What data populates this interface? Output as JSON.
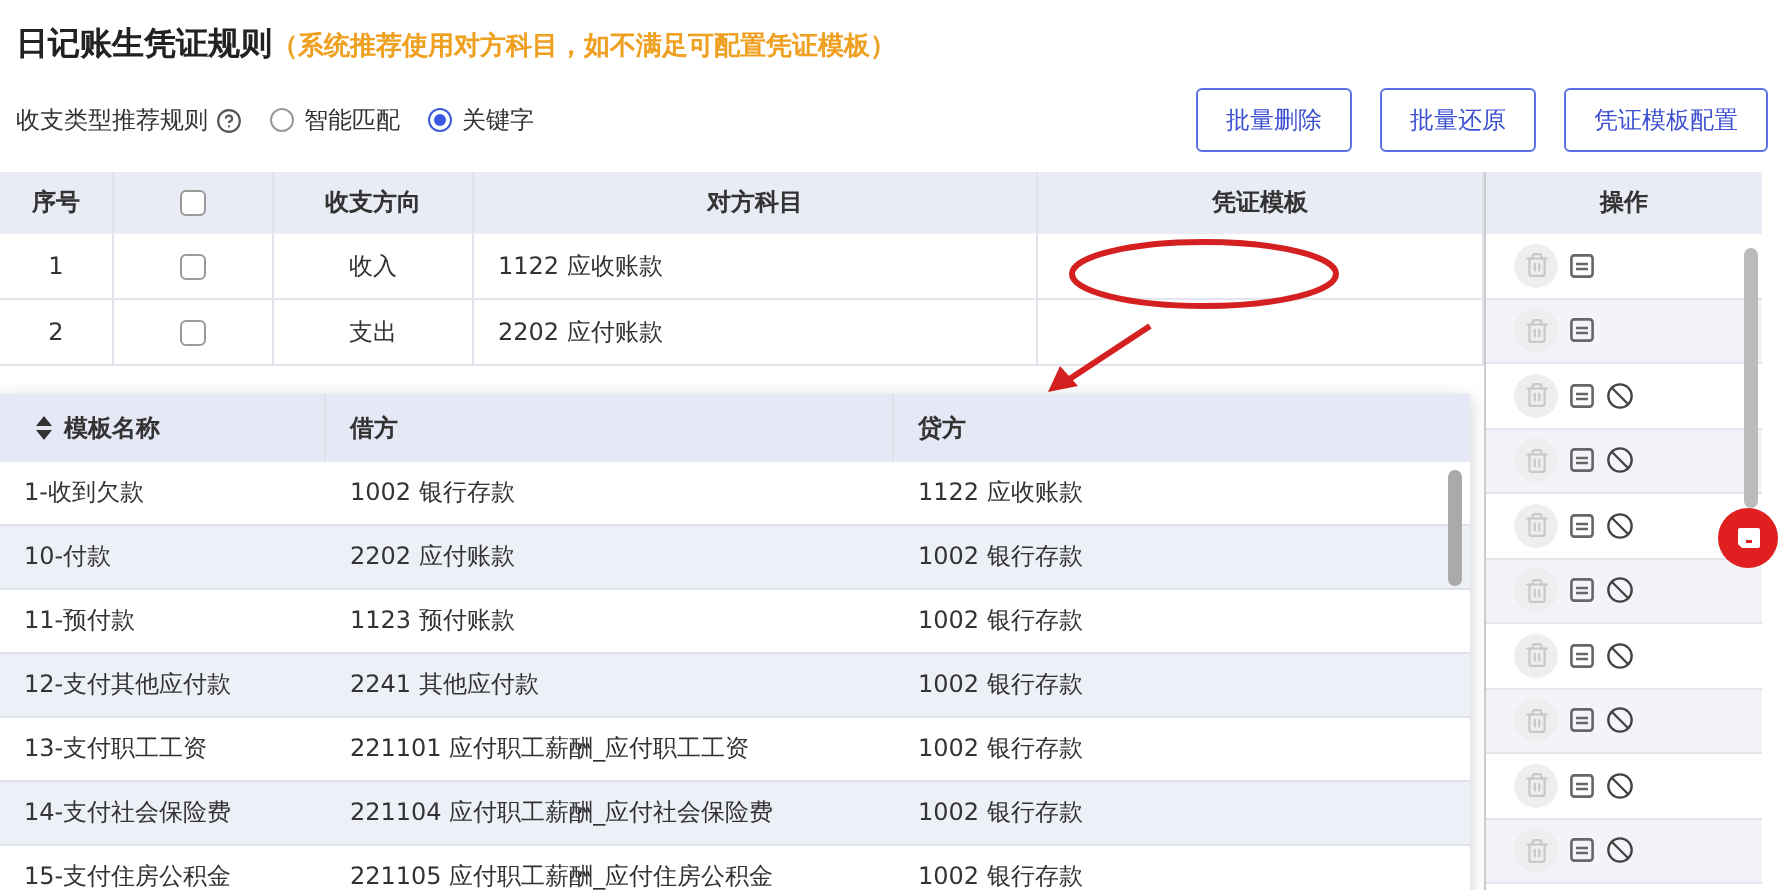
{
  "title": "日记账生凭证规则",
  "subtitle": "（系统推荐使用对方科目，如不满足可配置凭证模板）",
  "rule": {
    "label": "收支类型推荐规则",
    "options": [
      {
        "label": "智能匹配",
        "selected": false
      },
      {
        "label": "关键字",
        "selected": true
      }
    ]
  },
  "buttons": [
    "批量删除",
    "批量还原",
    "凭证模板配置"
  ],
  "table": {
    "columns": [
      {
        "kind": "text",
        "label": "序号"
      },
      {
        "kind": "checkbox",
        "checked": false
      },
      {
        "kind": "text",
        "label": "收支方向"
      },
      {
        "kind": "text",
        "label": "对方科目"
      },
      {
        "kind": "text",
        "label": "凭证模板"
      }
    ],
    "rows": [
      {
        "index": "1",
        "checked": false,
        "direction": "收入",
        "account": "1122 应收账款"
      },
      {
        "index": "2",
        "checked": false,
        "direction": "支出",
        "account": "2202 应付账款"
      }
    ]
  },
  "actions": {
    "header": "操作",
    "rows": [
      {
        "items": [
          {
            "kind": "delete",
            "disabled": true
          },
          {
            "kind": "edit"
          }
        ]
      },
      {
        "items": [
          {
            "kind": "delete",
            "disabled": true
          },
          {
            "kind": "edit"
          }
        ]
      },
      {
        "items": [
          {
            "kind": "delete",
            "disabled": true
          },
          {
            "kind": "edit"
          },
          {
            "kind": "ban"
          }
        ]
      },
      {
        "items": [
          {
            "kind": "delete",
            "disabled": true
          },
          {
            "kind": "edit"
          },
          {
            "kind": "ban"
          }
        ]
      },
      {
        "items": [
          {
            "kind": "delete",
            "disabled": true
          },
          {
            "kind": "edit"
          },
          {
            "kind": "ban"
          }
        ]
      },
      {
        "items": [
          {
            "kind": "delete",
            "disabled": true
          },
          {
            "kind": "edit"
          },
          {
            "kind": "ban"
          }
        ]
      },
      {
        "items": [
          {
            "kind": "delete",
            "disabled": true
          },
          {
            "kind": "edit"
          },
          {
            "kind": "ban"
          }
        ]
      },
      {
        "items": [
          {
            "kind": "delete",
            "disabled": true
          },
          {
            "kind": "edit"
          },
          {
            "kind": "ban"
          }
        ]
      },
      {
        "items": [
          {
            "kind": "delete",
            "disabled": true
          },
          {
            "kind": "edit"
          },
          {
            "kind": "ban"
          }
        ]
      },
      {
        "items": [
          {
            "kind": "delete",
            "disabled": true
          },
          {
            "kind": "edit"
          },
          {
            "kind": "ban"
          }
        ]
      }
    ]
  },
  "template_dropdown": {
    "columns": [
      "模板名称",
      "借方",
      "贷方"
    ],
    "rows": [
      {
        "name": "1-收到欠款",
        "debit": "1002 银行存款",
        "credit": "1122 应收账款"
      },
      {
        "name": "10-付款",
        "debit": "2202 应付账款",
        "credit": "1002 银行存款"
      },
      {
        "name": "11-预付款",
        "debit": "1123 预付账款",
        "credit": "1002 银行存款"
      },
      {
        "name": "12-支付其他应付款",
        "debit": "2241 其他应付款",
        "credit": "1002 银行存款"
      },
      {
        "name": "13-支付职工工资",
        "debit": "221101 应付职工薪酬_应付职工工资",
        "credit": "1002 银行存款"
      },
      {
        "name": "14-支付社会保险费",
        "debit": "221104 应付职工薪酬_应付社会保险费",
        "credit": "1002 银行存款"
      },
      {
        "name": "15-支付住房公积金",
        "debit": "221105 应付职工薪酬_应付住房公积金",
        "credit": "1002 银行存款"
      }
    ]
  }
}
